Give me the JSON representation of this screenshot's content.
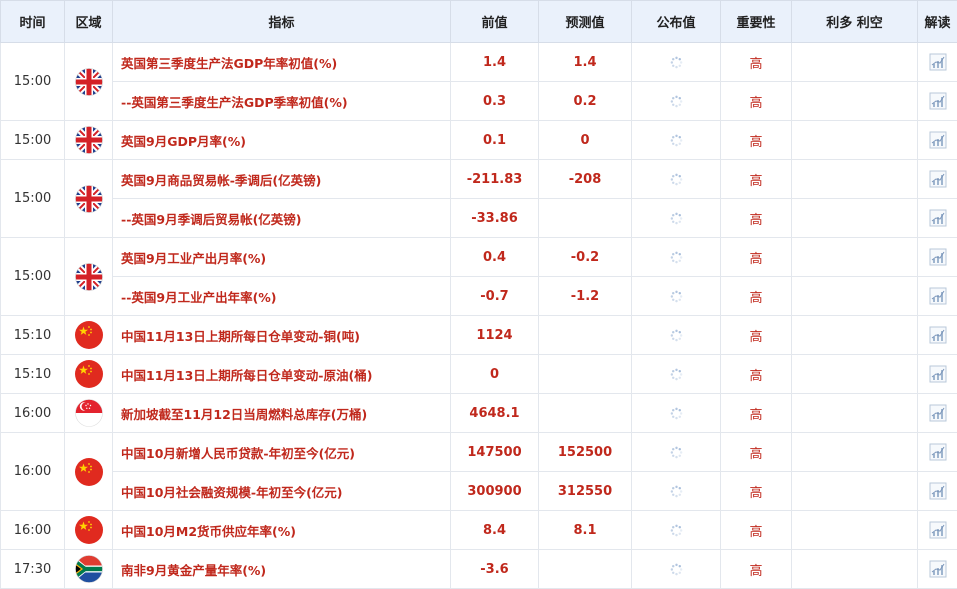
{
  "header": {
    "time": "时间",
    "region": "区域",
    "indicator": "指标",
    "previous": "前值",
    "forecast": "预测值",
    "actual": "公布值",
    "importance": "重要性",
    "impact": "利多 利空",
    "analysis": "解读"
  },
  "groups": [
    {
      "time": "15:00",
      "flag": "uk-flag",
      "rows": [
        {
          "indicator": "英国第三季度生产法GDP年率初值(%)",
          "previous": "1.4",
          "forecast": "1.4",
          "importance": "高"
        },
        {
          "indicator": "--英国第三季度生产法GDP季率初值(%)",
          "previous": "0.3",
          "forecast": "0.2",
          "importance": "高"
        }
      ]
    },
    {
      "time": "15:00",
      "flag": "uk-flag",
      "rows": [
        {
          "indicator": "英国9月GDP月率(%)",
          "previous": "0.1",
          "forecast": "0",
          "importance": "高"
        }
      ]
    },
    {
      "time": "15:00",
      "flag": "uk-flag",
      "rows": [
        {
          "indicator": "英国9月商品贸易帐-季调后(亿英镑)",
          "previous": "-211.83",
          "forecast": "-208",
          "importance": "高"
        },
        {
          "indicator": "--英国9月季调后贸易帐(亿英镑)",
          "previous": "-33.86",
          "forecast": "",
          "importance": "高"
        }
      ]
    },
    {
      "time": "15:00",
      "flag": "uk-flag",
      "rows": [
        {
          "indicator": "英国9月工业产出月率(%)",
          "previous": "0.4",
          "forecast": "-0.2",
          "importance": "高"
        },
        {
          "indicator": "--英国9月工业产出年率(%)",
          "previous": "-0.7",
          "forecast": "-1.2",
          "importance": "高"
        }
      ]
    },
    {
      "time": "15:10",
      "flag": "cn-flag",
      "rows": [
        {
          "indicator": "中国11月13日上期所每日仓单变动-铜(吨)",
          "previous": "1124",
          "forecast": "",
          "importance": "高"
        }
      ]
    },
    {
      "time": "15:10",
      "flag": "cn-flag",
      "rows": [
        {
          "indicator": "中国11月13日上期所每日仓单变动-原油(桶)",
          "previous": "0",
          "forecast": "",
          "importance": "高"
        }
      ]
    },
    {
      "time": "16:00",
      "flag": "sg-flag",
      "rows": [
        {
          "indicator": "新加坡截至11月12日当周燃料总库存(万桶)",
          "previous": "4648.1",
          "forecast": "",
          "importance": "高"
        }
      ]
    },
    {
      "time": "16:00",
      "flag": "cn-flag",
      "rows": [
        {
          "indicator": "中国10月新增人民币贷款-年初至今(亿元)",
          "previous": "147500",
          "forecast": "152500",
          "importance": "高"
        },
        {
          "indicator": "中国10月社会融资规模-年初至今(亿元)",
          "previous": "300900",
          "forecast": "312550",
          "importance": "高"
        }
      ]
    },
    {
      "time": "16:00",
      "flag": "cn-flag",
      "rows": [
        {
          "indicator": "中国10月M2货币供应年率(%)",
          "previous": "8.4",
          "forecast": "8.1",
          "importance": "高"
        }
      ]
    },
    {
      "time": "17:30",
      "flag": "za-flag",
      "rows": [
        {
          "indicator": "南非9月黄金产量年率(%)",
          "previous": "-3.6",
          "forecast": "",
          "importance": "高"
        }
      ]
    }
  ]
}
